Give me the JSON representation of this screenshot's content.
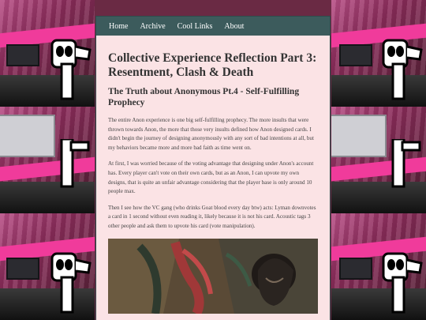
{
  "nav": {
    "items": [
      "Home",
      "Archive",
      "Cool Links",
      "About"
    ]
  },
  "article": {
    "title": "Collective Experience Reflection Part 3: Resentment, Clash & Death",
    "subtitle": "The Truth about Anonymous Pt.4 - Self-Fulfilling Prophecy",
    "paragraphs": [
      "The entire Anon experience is one big self-fulfilling prophecy. The more insults that were thrown towards Anon, the more that those very insults defined how Anon designed cards. I didn't begin the journey of designing anonymously with any sort of bad intentions at all, but my behaviors became more and more bad faith as time went on.",
      "At first, I was worried because of the voting advantage that designing under Anon's account has. Every player can't vote on their own cards, but as an Anon, I can upvote my own designs, that is quite an unfair advantage considering that the player base is only around 10 people max.",
      "Then I see how the VC gang (who drinks Goat blood every day btw) acts: Lyman downvotes a card in 1 second without even reading it, likely because it is not his card. Acoustic tags 3 other people and ask them to upvote his card (vote manipulation)."
    ]
  },
  "colors": {
    "nav_bg": "#3c5b5c",
    "card_bg": "#fbe3e5",
    "heading": "#333333",
    "body_text": "#444444",
    "bg_magenta": "#f03b9b"
  },
  "icons": {
    "background": "pixel-character-pattern",
    "artwork": "card-art-illustration"
  }
}
